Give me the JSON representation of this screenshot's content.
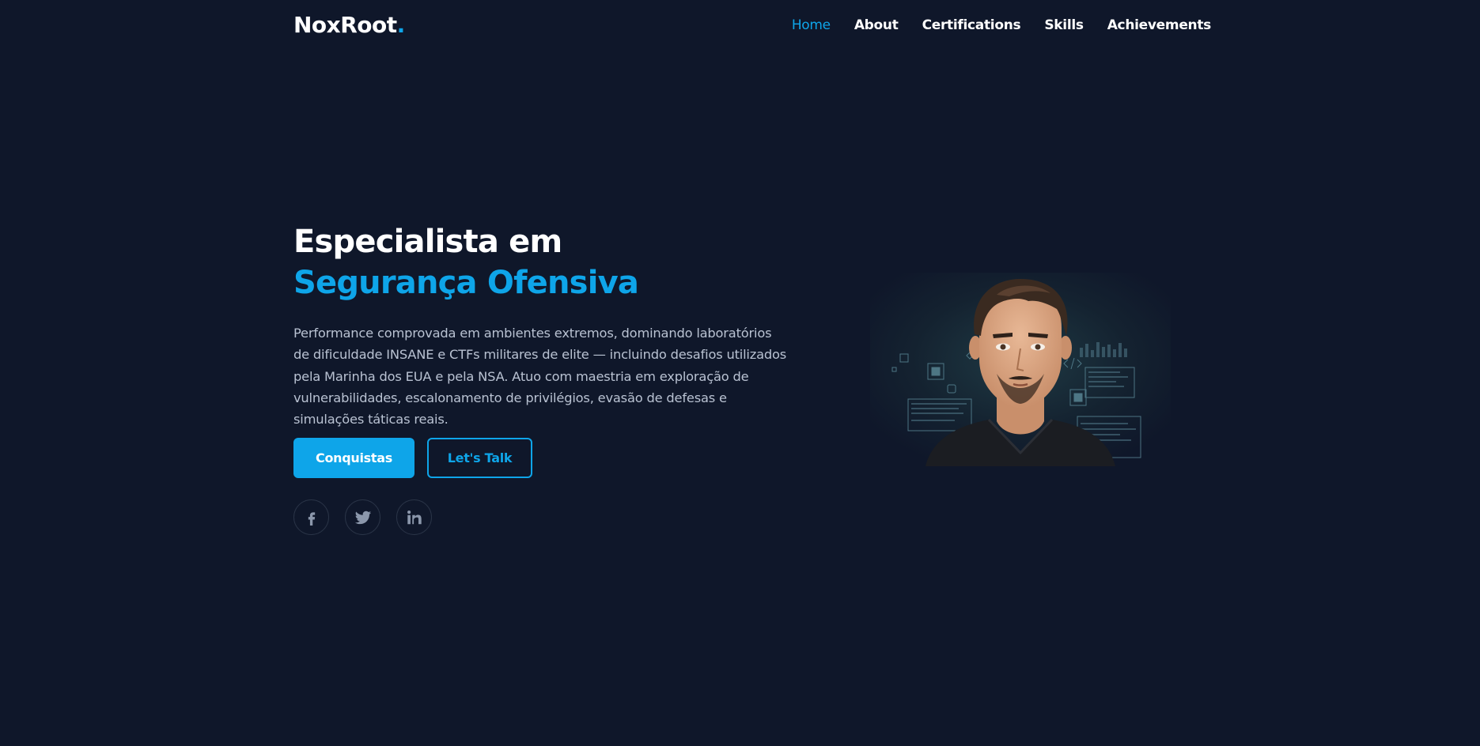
{
  "nav": {
    "logo_text": "NoxRoot",
    "logo_dot": ".",
    "links": [
      {
        "label": "Home"
      },
      {
        "label": "About"
      },
      {
        "label": "Certifications"
      },
      {
        "label": "Skills"
      },
      {
        "label": "Achievements"
      }
    ]
  },
  "hero": {
    "title_line1": "Especialista em",
    "title_line2": "Segurança Ofensiva",
    "description": "Performance comprovada em ambientes extremos, dominando laboratórios de dificuldade INSANE e CTFs militares de elite — incluindo desafios utilizados pela Marinha dos EUA e pela NSA. Atuo com maestria em exploração de vulnerabilidades, escalonamento de privilégios, evasão de defesas e simulações táticas reais.",
    "primary_button": "Conquistas",
    "secondary_button": "Let's Talk"
  },
  "socials": [
    {
      "icon": "facebook-icon"
    },
    {
      "icon": "twitter-icon"
    },
    {
      "icon": "linkedin-icon"
    }
  ],
  "colors": {
    "background": "#0f172a",
    "accent": "#0ea5e9",
    "text": "#ffffff",
    "muted": "#b9c2d2"
  }
}
